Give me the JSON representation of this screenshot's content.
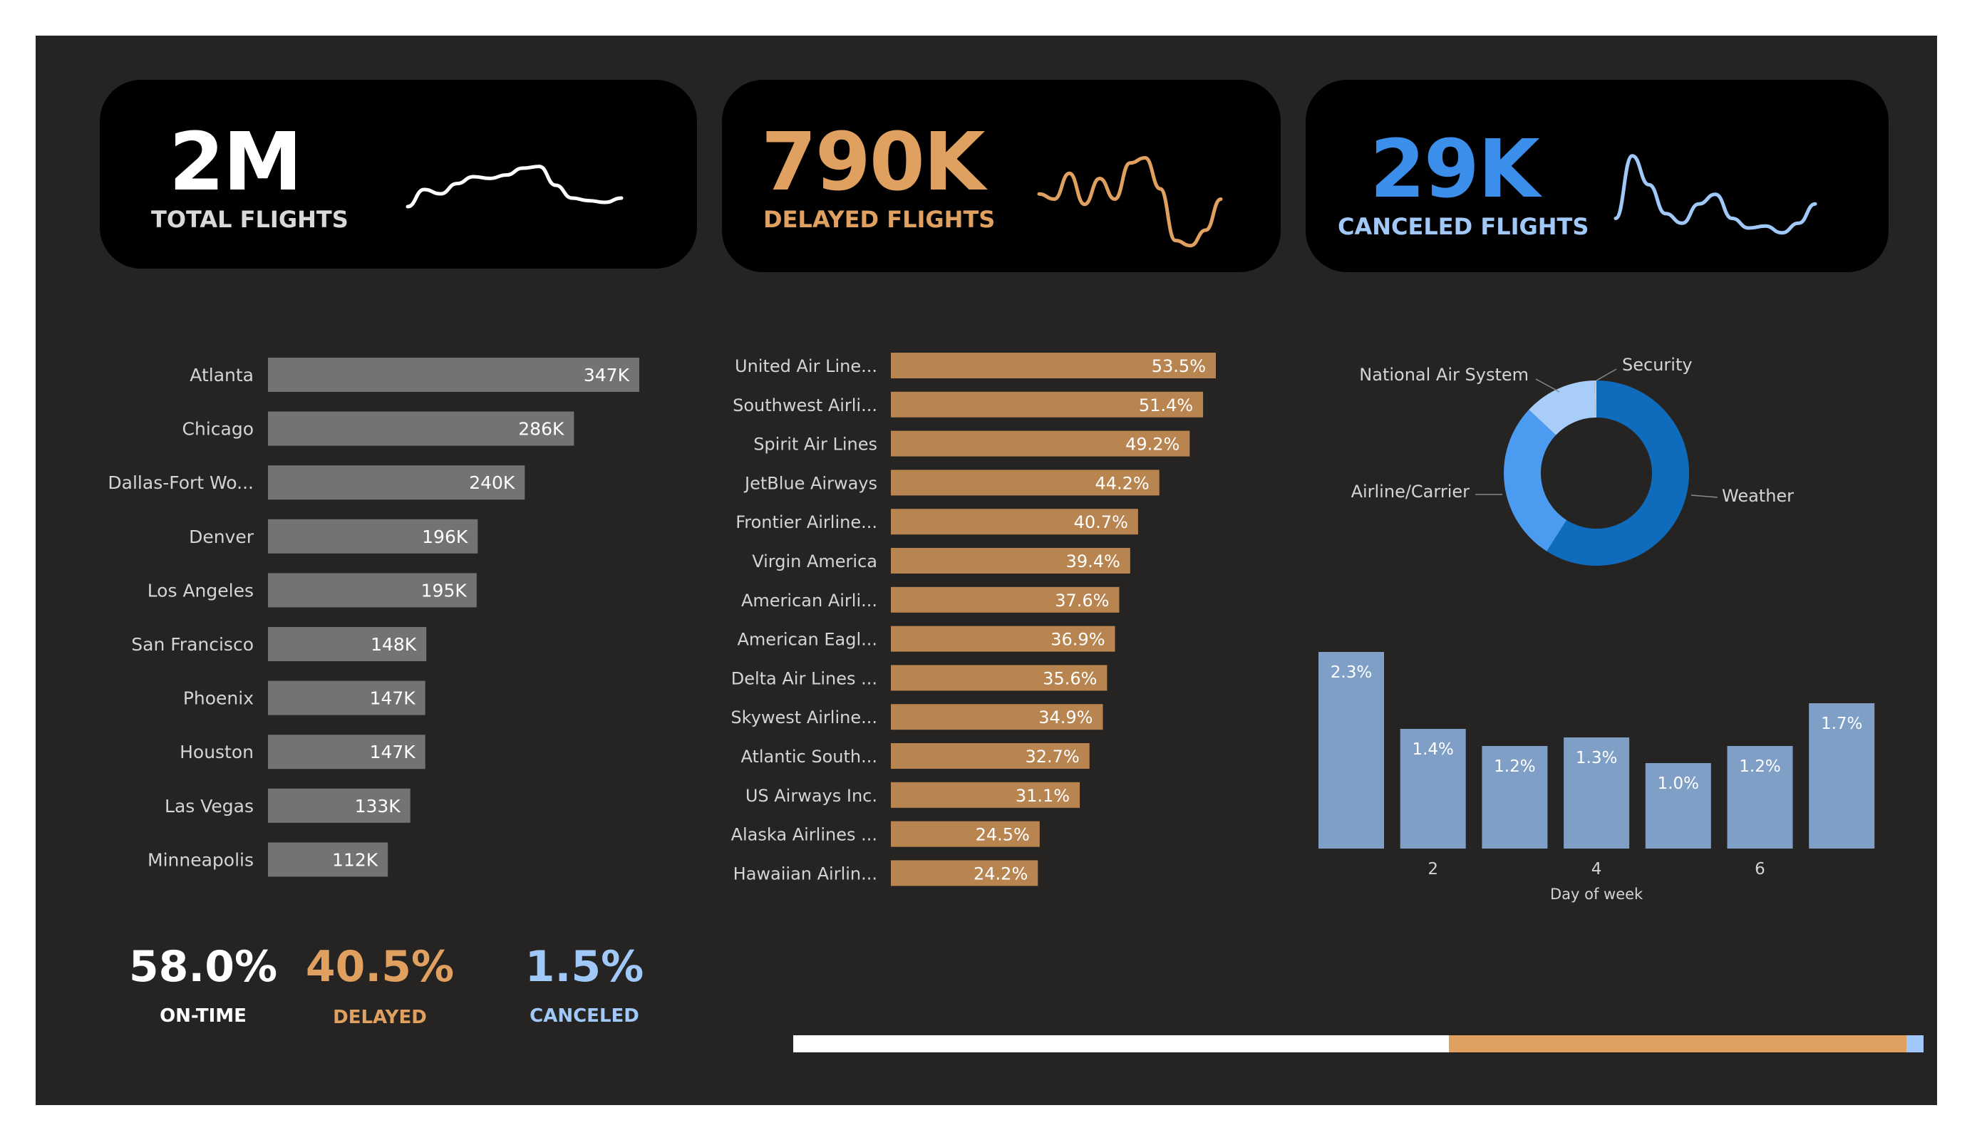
{
  "kpis": [
    {
      "value": "2M",
      "label": "TOTAL FLIGHTS",
      "color": "#ffffff",
      "label_color": "#d9d9d9",
      "sparkline": [
        0.35,
        0.55,
        0.5,
        0.62,
        0.7,
        0.68,
        0.72,
        0.8,
        0.82,
        0.6,
        0.45,
        0.42,
        0.4,
        0.45
      ]
    },
    {
      "value": "790K",
      "label": "DELAYED FLIGHTS",
      "color": "#e0a060",
      "label_color": "#e0a060",
      "sparkline": [
        0.55,
        0.5,
        0.75,
        0.45,
        0.7,
        0.5,
        0.85,
        0.9,
        0.6,
        0.1,
        0.05,
        0.2,
        0.5
      ]
    },
    {
      "value": "29K",
      "label": "CANCELED FLIGHTS",
      "color": "#3b8eea",
      "label_color": "#a0c8f8",
      "sparkline": [
        0.3,
        0.95,
        0.65,
        0.35,
        0.25,
        0.45,
        0.55,
        0.3,
        0.2,
        0.22,
        0.15,
        0.25,
        0.45
      ]
    }
  ],
  "colors": {
    "gray_bar": "#737373",
    "orange_bar": "#b88450",
    "blue_bar": "#7f9fc7",
    "donut": [
      "#0f6cbd",
      "#4b9bf0",
      "#a8cdf8"
    ],
    "text_light": "#d4d4d4",
    "label_white": "#ffffff"
  },
  "stats": [
    {
      "value": "58.0%",
      "label": "ON-TIME",
      "color": "#ffffff"
    },
    {
      "value": "40.5%",
      "label": "DELAYED",
      "color": "#e0a060"
    },
    {
      "value": "1.5%",
      "label": "CANCELED",
      "color": "#a0c8f8"
    }
  ],
  "chart_data": [
    {
      "type": "bar",
      "orientation": "horizontal",
      "categories": [
        "Atlanta",
        "Chicago",
        "Dallas-Fort Wo...",
        "Denver",
        "Los Angeles",
        "San Francisco",
        "Phoenix",
        "Houston",
        "Las Vegas",
        "Minneapolis"
      ],
      "values": [
        347,
        286,
        240,
        196,
        195,
        148,
        147,
        147,
        133,
        112
      ],
      "labels": [
        "347K",
        "286K",
        "240K",
        "196K",
        "195K",
        "148K",
        "147K",
        "147K",
        "133K",
        "112K"
      ],
      "xlim": [
        0,
        347
      ]
    },
    {
      "type": "bar",
      "orientation": "horizontal",
      "categories": [
        "United Air Line...",
        "Southwest Airli...",
        "Spirit Air Lines",
        "JetBlue Airways",
        "Frontier Airline...",
        "Virgin America",
        "American Airli...",
        "American Eagl...",
        "Delta Air Lines ...",
        "Skywest Airline...",
        "Atlantic South...",
        "US Airways Inc.",
        "Alaska Airlines ...",
        "Hawaiian Airlin..."
      ],
      "values": [
        53.5,
        51.4,
        49.2,
        44.2,
        40.7,
        39.4,
        37.6,
        36.9,
        35.6,
        34.9,
        32.7,
        31.1,
        24.5,
        24.2
      ],
      "labels": [
        "53.5%",
        "51.4%",
        "49.2%",
        "44.2%",
        "40.7%",
        "39.4%",
        "37.6%",
        "36.9%",
        "35.6%",
        "34.9%",
        "32.7%",
        "31.1%",
        "24.5%",
        "24.2%"
      ],
      "xlim": [
        0,
        53.5
      ]
    },
    {
      "type": "pie",
      "donut": true,
      "categories": [
        "Weather",
        "Airline/Carrier",
        "National Air System",
        "Security"
      ],
      "values": [
        59,
        28,
        12.7,
        0.3
      ]
    },
    {
      "type": "bar",
      "categories": [
        1,
        2,
        3,
        4,
        5,
        6,
        7
      ],
      "values": [
        2.3,
        1.4,
        1.2,
        1.3,
        1.0,
        1.2,
        1.7
      ],
      "labels": [
        "2.3%",
        "1.4%",
        "1.2%",
        "1.3%",
        "1.0%",
        "1.2%",
        "1.7%"
      ],
      "xticks": [
        "2",
        "4",
        "6"
      ],
      "xlabel": "Day of week",
      "ylim": [
        0,
        2.3
      ]
    },
    {
      "type": "bar",
      "orientation": "horizontal",
      "stacked": true,
      "values": [
        58.0,
        40.5,
        1.5
      ],
      "colors": [
        "#ffffff",
        "#e0a060",
        "#a0c8f8"
      ]
    }
  ]
}
